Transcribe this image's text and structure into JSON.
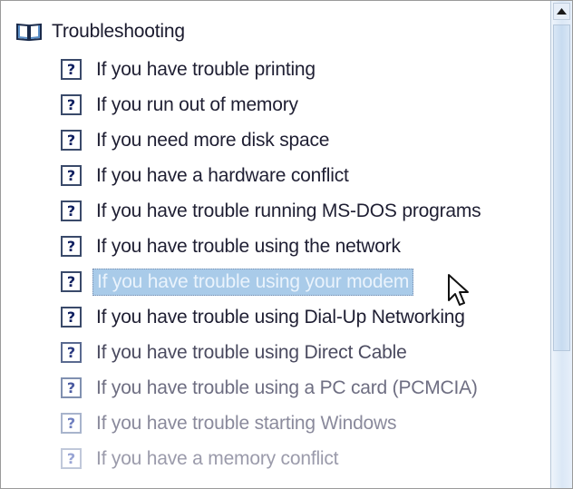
{
  "tree": {
    "root": {
      "label": "Troubleshooting",
      "icon": "open-book-icon"
    },
    "topics": [
      {
        "label": "If you have trouble printing",
        "icon": "help-topic-icon",
        "glyph": "?"
      },
      {
        "label": "If you run out of memory",
        "icon": "help-topic-icon",
        "glyph": "?"
      },
      {
        "label": "If you need more disk space",
        "icon": "help-topic-icon",
        "glyph": "?"
      },
      {
        "label": "If you have a hardware conflict",
        "icon": "help-topic-icon",
        "glyph": "?"
      },
      {
        "label": "If you have trouble running MS-DOS programs",
        "icon": "help-topic-icon",
        "glyph": "?"
      },
      {
        "label": "If you have trouble using the network",
        "icon": "help-topic-icon",
        "glyph": "?"
      },
      {
        "label": "If you have trouble using your modem",
        "icon": "help-topic-icon",
        "glyph": "?",
        "selected": true
      },
      {
        "label": "If you have trouble using Dial-Up Networking",
        "icon": "help-topic-icon",
        "glyph": "?"
      },
      {
        "label": "If you have trouble using Direct Cable",
        "icon": "help-topic-icon",
        "glyph": "?"
      },
      {
        "label": "If you have trouble using a PC card (PCMCIA)",
        "icon": "help-topic-icon",
        "glyph": "?"
      },
      {
        "label": "If you have trouble starting Windows",
        "icon": "help-topic-icon",
        "glyph": "?"
      },
      {
        "label": "If you have a memory conflict",
        "icon": "help-topic-icon",
        "glyph": "?"
      }
    ]
  },
  "colors": {
    "selection_background": "#a9cbe9",
    "selection_text": "#eaf3fc",
    "text": "#1f1f33"
  },
  "scrollbar": {
    "up_icon": "scroll-up-arrow-icon"
  },
  "cursor": {
    "icon": "mouse-pointer-icon"
  }
}
